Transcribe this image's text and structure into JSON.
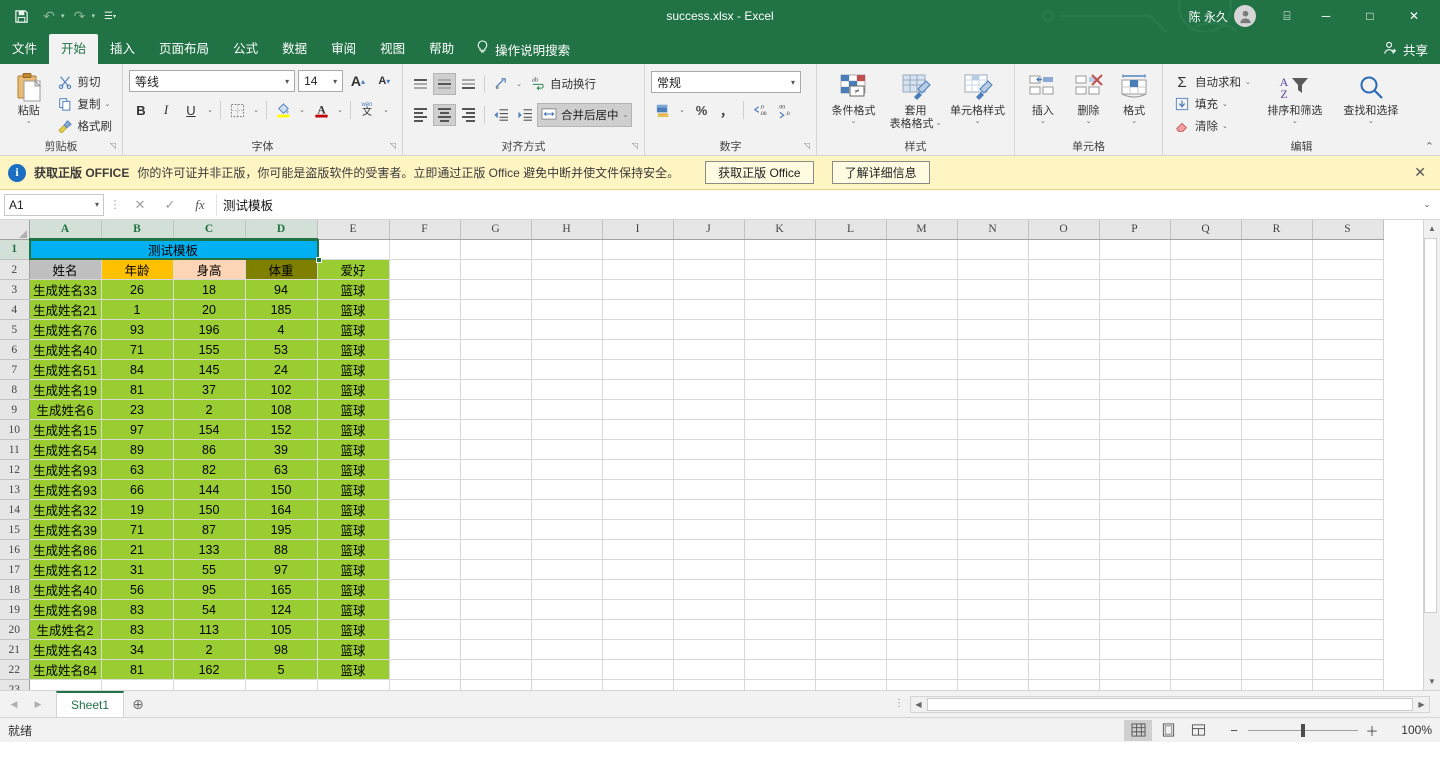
{
  "titlebar": {
    "document_title": "success.xlsx  -  Excel",
    "user_name": "陈 永久",
    "quick_access": [
      {
        "name": "save",
        "glyph": "💾"
      },
      {
        "name": "undo",
        "glyph": "↶"
      },
      {
        "name": "redo",
        "glyph": "↷"
      },
      {
        "name": "customize",
        "glyph": "☰"
      }
    ],
    "ribbon_display_options": "⌸",
    "minimize": "─",
    "maximize": "□",
    "close": "✕"
  },
  "tabs": [
    {
      "label": "文件",
      "active": false
    },
    {
      "label": "开始",
      "active": true
    },
    {
      "label": "插入",
      "active": false
    },
    {
      "label": "页面布局",
      "active": false
    },
    {
      "label": "公式",
      "active": false
    },
    {
      "label": "数据",
      "active": false
    },
    {
      "label": "审阅",
      "active": false
    },
    {
      "label": "视图",
      "active": false
    },
    {
      "label": "帮助",
      "active": false
    }
  ],
  "tellme": {
    "label": "操作说明搜索",
    "icon": "lightbulb-icon"
  },
  "share": {
    "label": "共享",
    "icon": "share-person-icon"
  },
  "ribbon": {
    "clipboard": {
      "group_label": "剪贴板",
      "paste": "粘贴",
      "cut": "剪切",
      "copy": "复制",
      "format_painter": "格式刷"
    },
    "font": {
      "group_label": "字体",
      "font_name": "等线",
      "font_size": "14",
      "grow_font": "A",
      "shrink_font": "A",
      "bold": "B",
      "italic": "I",
      "underline": "U",
      "borders": "田",
      "fill_color": "A",
      "font_color": "A",
      "phonetic": "wén"
    },
    "alignment": {
      "group_label": "对齐方式",
      "wrap_text": "自动换行",
      "merge_center": "合并后居中"
    },
    "number": {
      "group_label": "数字",
      "format": "常规",
      "percent": "%",
      "comma": "，",
      "increase_decimal": ".00",
      "decrease_decimal": ".00"
    },
    "styles": {
      "group_label": "样式",
      "conditional_format": "条件格式",
      "table_format_line1": "套用",
      "table_format_line2": "表格格式",
      "cell_styles": "单元格样式"
    },
    "cells": {
      "group_label": "单元格",
      "insert": "插入",
      "delete": "删除",
      "format": "格式"
    },
    "editing": {
      "group_label": "编辑",
      "autosum": "自动求和",
      "fill": "填充",
      "clear": "清除",
      "sort_filter": "排序和筛选",
      "find_select": "查找和选择"
    },
    "collapse": "⌃"
  },
  "notice": {
    "title": "获取正版 OFFICE",
    "message": "你的许可证并非正版，你可能是盗版软件的受害者。立即通过正版 Office 避免中断并使文件保持安全。",
    "button_primary": "获取正版 Office",
    "button_secondary": "了解详细信息",
    "close": "✕"
  },
  "formula_bar": {
    "name_box": "A1",
    "cancel": "✕",
    "enter": "✓",
    "insert_function": "fx",
    "value": "测试模板",
    "expand": "⌄"
  },
  "grid": {
    "column_headers": [
      "A",
      "B",
      "C",
      "D",
      "E",
      "F",
      "G",
      "H",
      "I",
      "J",
      "K",
      "L",
      "M",
      "N",
      "O",
      "P",
      "Q",
      "R",
      "S"
    ],
    "selected_column_range": [
      "A",
      "B",
      "C",
      "D"
    ],
    "row_numbers": [
      1,
      2,
      3,
      4,
      5,
      6,
      7,
      8,
      9,
      10,
      11,
      12,
      13,
      14,
      15,
      16,
      17,
      18,
      19,
      20,
      21,
      22
    ],
    "selected_row": 1,
    "title_cell": "测试模板",
    "headers": [
      "姓名",
      "年龄",
      "身高",
      "体重",
      "爱好"
    ],
    "rows": [
      [
        "生成姓名33",
        "26",
        "18",
        "94",
        "篮球"
      ],
      [
        "生成姓名21",
        "1",
        "20",
        "185",
        "篮球"
      ],
      [
        "生成姓名76",
        "93",
        "196",
        "4",
        "篮球"
      ],
      [
        "生成姓名40",
        "71",
        "155",
        "53",
        "篮球"
      ],
      [
        "生成姓名51",
        "84",
        "145",
        "24",
        "篮球"
      ],
      [
        "生成姓名19",
        "81",
        "37",
        "102",
        "篮球"
      ],
      [
        "生成姓名6",
        "23",
        "2",
        "108",
        "篮球"
      ],
      [
        "生成姓名15",
        "97",
        "154",
        "152",
        "篮球"
      ],
      [
        "生成姓名54",
        "89",
        "86",
        "39",
        "篮球"
      ],
      [
        "生成姓名93",
        "63",
        "82",
        "63",
        "篮球"
      ],
      [
        "生成姓名93",
        "66",
        "144",
        "150",
        "篮球"
      ],
      [
        "生成姓名32",
        "19",
        "150",
        "164",
        "篮球"
      ],
      [
        "生成姓名39",
        "71",
        "87",
        "195",
        "篮球"
      ],
      [
        "生成姓名86",
        "21",
        "133",
        "88",
        "篮球"
      ],
      [
        "生成姓名12",
        "31",
        "55",
        "97",
        "篮球"
      ],
      [
        "生成姓名40",
        "56",
        "95",
        "165",
        "篮球"
      ],
      [
        "生成姓名98",
        "83",
        "54",
        "124",
        "篮球"
      ],
      [
        "生成姓名2",
        "83",
        "113",
        "105",
        "篮球"
      ],
      [
        "生成姓名43",
        "34",
        "2",
        "98",
        "篮球"
      ],
      [
        "生成姓名84",
        "81",
        "162",
        "5",
        "篮球"
      ]
    ],
    "colors": {
      "title_fill": "#00B0F0",
      "header_name": "#BFBFBF",
      "header_age": "#FFC000",
      "header_height": "#FBD5B5",
      "header_weight": "#808000",
      "header_hobby": "#9ACD32",
      "body_fill": "#9ACD32",
      "selection_border": "#217346"
    }
  },
  "sheet_tabs": {
    "prev": "◀",
    "next": "▶",
    "tabs": [
      {
        "label": "Sheet1",
        "active": true
      }
    ],
    "add": "⊕"
  },
  "status_bar": {
    "status": "就绪",
    "views": [
      {
        "name": "normal-view",
        "glyph": "▦",
        "active": true
      },
      {
        "name": "page-layout-view",
        "glyph": "▤",
        "active": false
      },
      {
        "name": "page-break-view",
        "glyph": "▥",
        "active": false
      }
    ],
    "zoom_out": "−",
    "zoom_in": "＋",
    "zoom_level": "100%"
  }
}
